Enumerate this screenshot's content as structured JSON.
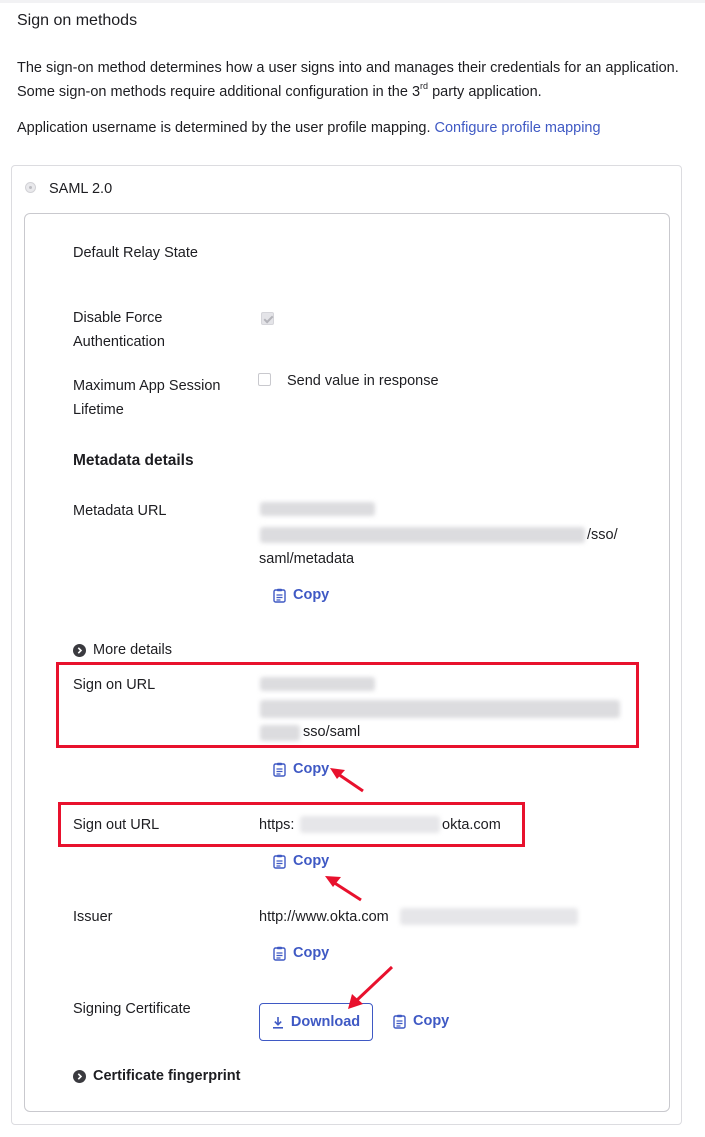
{
  "page": {
    "section_title": "Sign on methods",
    "intro": {
      "text_before_sup": "The sign-on method determines how a user signs into and manages their credentials for an application. Some sign-on methods require additional configuration in the 3",
      "sup": "rd",
      "text_after_sup": " party application."
    },
    "profile_mapping": {
      "text": "Application username is determined by the user profile mapping. ",
      "link": "Configure profile mapping"
    }
  },
  "saml": {
    "radio_label": "SAML 2.0",
    "default_relay_state_label": "Default Relay State",
    "disable_force_auth_label_line1": "Disable Force",
    "disable_force_auth_label_line2": "Authentication",
    "max_session_label_line1": "Maximum App Session",
    "max_session_label_line2": "Lifetime",
    "send_value_label": "Send value in response",
    "metadata_heading": "Metadata details",
    "metadata_url_label": "Metadata URL",
    "metadata_url_tail_1": "/sso/",
    "metadata_url_tail_2": "saml/metadata",
    "copy_label": "Copy",
    "more_details_label": "More details",
    "sign_on_url_label": "Sign on URL",
    "sign_on_url_tail": "sso/saml",
    "sign_out_url_label": "Sign out URL",
    "sign_out_url_prefix": "https:",
    "sign_out_url_suffix": "okta.com",
    "issuer_label": "Issuer",
    "issuer_value": "http://www.okta.com",
    "signing_cert_label": "Signing Certificate",
    "download_label": "Download",
    "cert_fingerprint_label": "Certificate fingerprint"
  },
  "colors": {
    "link": "#3f59c4",
    "highlight": "#e8112d",
    "text": "#1d1d21",
    "border": "#c9c9ce"
  },
  "icons": {
    "copy": "clipboard-icon",
    "expand": "chevron-right-circle-icon",
    "download": "download-icon",
    "radio": "radio-button",
    "checkbox": "checkbox"
  }
}
